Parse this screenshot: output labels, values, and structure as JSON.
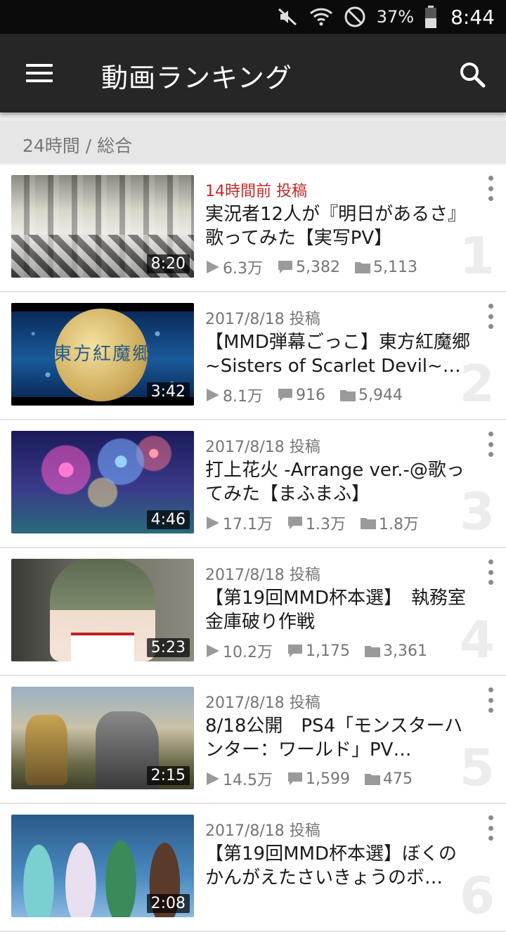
{
  "status_bar": {
    "battery_percent": "37%",
    "time": "8:44",
    "icons": [
      "mute-icon",
      "wifi-icon",
      "do-not-disturb-icon",
      "battery-icon"
    ]
  },
  "app_bar": {
    "title": "動画ランキング",
    "icons": [
      "menu-icon",
      "search-icon"
    ]
  },
  "filter": {
    "label": "24時間 / 総合"
  },
  "colors": {
    "recent_post": "#c62828",
    "app_bar": "#262626",
    "status_bar": "#0b0b0b"
  },
  "videos": [
    {
      "rank": "1",
      "posted": "14時間前 投稿",
      "title": "実況者12人が『明日があるさ』歌ってみた【実写PV】",
      "duration": "8:20",
      "views": "6.3万",
      "comments": "5,382",
      "mylists": "5,113"
    },
    {
      "rank": "2",
      "posted": "2017/8/18 投稿",
      "title": "【MMD弾幕ごっこ】東方紅魔郷 ~Sisters of Scarlet Devil~…",
      "duration": "3:42",
      "views": "8.1万",
      "comments": "916",
      "mylists": "5,944",
      "thumb_text": "東方紅魔郷"
    },
    {
      "rank": "3",
      "posted": "2017/8/18 投稿",
      "title": "打上花火 -Arrange ver.-@歌ってみた【まふまふ】",
      "duration": "4:46",
      "views": "17.1万",
      "comments": "1.3万",
      "mylists": "1.8万"
    },
    {
      "rank": "4",
      "posted": "2017/8/18 投稿",
      "title": "【第19回MMD杯本選】　執務室 金庫破り作戦",
      "duration": "5:23",
      "views": "10.2万",
      "comments": "1,175",
      "mylists": "3,361"
    },
    {
      "rank": "5",
      "posted": "2017/8/18 投稿",
      "title": "8/18公開　PS4「モンスターハンター：ワールド」PV…",
      "duration": "2:15",
      "views": "14.5万",
      "comments": "1,599",
      "mylists": "475"
    },
    {
      "rank": "6",
      "posted": "2017/8/18 投稿",
      "title": "【第19回MMD杯本選】ぼくのかんがえたさいきょうのボ…",
      "duration": "2:08",
      "views": "",
      "comments": "",
      "mylists": ""
    }
  ]
}
